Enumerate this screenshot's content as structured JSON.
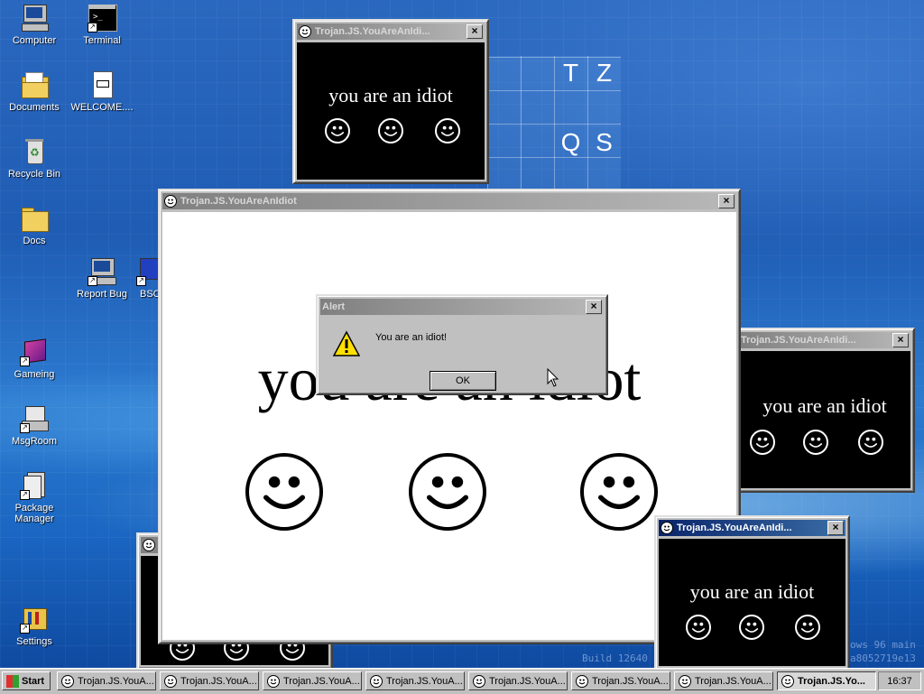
{
  "desktop": {
    "icons": [
      {
        "label": "Computer"
      },
      {
        "label": "Terminal"
      },
      {
        "label": "Documents"
      },
      {
        "label": "WELCOME...."
      },
      {
        "label": "Recycle Bin"
      },
      {
        "label": "Docs"
      },
      {
        "label": "Report Bug"
      },
      {
        "label": "BSO"
      },
      {
        "label": "Gameing"
      },
      {
        "label": "MsgRoom"
      },
      {
        "label": "Package Manager"
      },
      {
        "label": "Settings"
      }
    ],
    "tiles": [
      "T",
      "Z",
      "Q",
      "S"
    ],
    "watermark": {
      "line1": "ows 96 main",
      "line2": "a8052719e13",
      "build": "Build 12640"
    }
  },
  "windows": {
    "top_small": {
      "title": "Trojan.JS.YouAreAnIdi...",
      "text": "you are an idiot"
    },
    "right_small": {
      "title": "Trojan.JS.YouAreAnIdi...",
      "text": "you are an idiot"
    },
    "bottom_small": {
      "title": "Trojan.JS.YouAreAnIdi...",
      "text": "you are an idiot"
    },
    "big": {
      "title": "Trojan.JS.YouAreAnIdiot",
      "text": "you are an idiot"
    }
  },
  "alert": {
    "title": "Alert",
    "message": "You are an idiot!",
    "ok_label": "OK"
  },
  "taskbar": {
    "start_label": "Start",
    "buttons": [
      {
        "label": "Trojan.JS.YouA..."
      },
      {
        "label": "Trojan.JS.YouA..."
      },
      {
        "label": "Trojan.JS.YouA..."
      },
      {
        "label": "Trojan.JS.YouA..."
      },
      {
        "label": "Trojan.JS.YouA..."
      },
      {
        "label": "Trojan.JS.YouA..."
      },
      {
        "label": "Trojan.JS.YouA..."
      },
      {
        "label": "Trojan.JS.Yo..."
      }
    ],
    "clock": "16:37"
  },
  "colors": {
    "titlebar_active": "#0a246a",
    "titlebar_inactive": "#808080",
    "desktop": "#1f5cb4"
  }
}
